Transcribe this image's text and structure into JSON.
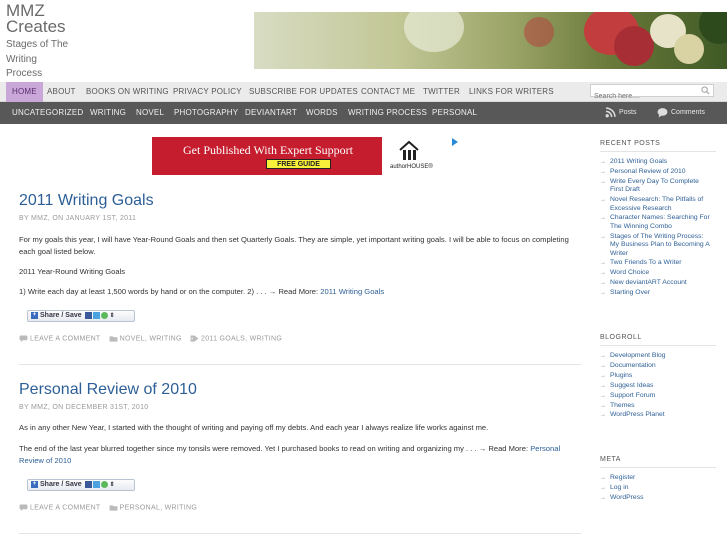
{
  "site": {
    "name_line1": "MMZ",
    "name_line2": "Creates",
    "desc_line1": "Stages of The",
    "desc_line2": "Writing",
    "desc_line3": "Process"
  },
  "nav_primary": {
    "items": [
      "HOME",
      "ABOUT",
      "BOOKS ON WRITING",
      "PRIVACY POLICY",
      "SUBSCRIBE FOR UPDATES",
      "CONTACT ME",
      "TWITTER",
      "LINKS FOR WRITERS"
    ],
    "active": "HOME"
  },
  "search": {
    "placeholder": "Search here...."
  },
  "nav_categories": {
    "items": [
      "UNCATEGORIZED",
      "WRITING",
      "NOVEL",
      "PHOTOGRAPHY",
      "DEVIANTART",
      "WORDS",
      "WRITING PROCESS",
      "PERSONAL"
    ],
    "feeds": [
      "Posts",
      "Comments"
    ]
  },
  "ad": {
    "headline": "Get Published With Expert Support",
    "badge": "FREE GUIDE",
    "brand": "authorHOUSE®"
  },
  "posts": [
    {
      "title": "2011 Writing Goals",
      "meta": "BY MMZ, ON JANUARY 1ST, 2011",
      "para1": "For my goals this year, I will have Year-Round Goals and then set Quarterly Goals. They are simple, yet important writing goals. I will be able to focus on completing each goal listed below.",
      "para2": "2011 Year-Round Writing Goals",
      "para3": "1) Write each day at least 1,500 words by hand or on the computer. 2) . . . → Read More:",
      "read_more": "2011 Writing Goals",
      "share": "Share / Save",
      "comment": "LEAVE A COMMENT",
      "categories": "NOVEL, WRITING",
      "tags": "2011 GOALS, WRITING"
    },
    {
      "title": "Personal Review of 2010",
      "meta": "BY MMZ, ON DECEMBER 31ST, 2010",
      "para1": "As in any other New Year, I started with the thought of writing and paying off my debts. And each year I always realize life works against me.",
      "para2": "The end of the last year blurred together since my tonsils were removed. Yet I purchased books to read on writing and organizing my . . . → Read More:",
      "read_more": "Personal Review of 2010",
      "share": "Share / Save",
      "comment": "LEAVE A COMMENT",
      "categories": "PERSONAL, WRITING"
    }
  ],
  "sidebar": {
    "recent_head": "RECENT POSTS",
    "recent": [
      "2011 Writing Goals",
      "Personal Review of 2010",
      "Write Every Day To Complete First Draft",
      "Novel Research: The Pitfalls of Excessive Research",
      "Character Names: Searching For The Winning Combo",
      "Stages of The Writing Process: My Business Plan to Becoming A Writer",
      "Two Friends To a Writer",
      "Word Choice",
      "New deviantART Account",
      "Starting Over"
    ],
    "blogroll_head": "BLOGROLL",
    "blogroll": [
      "Development Blog",
      "Documentation",
      "Plugins",
      "Suggest Ideas",
      "Support Forum",
      "Themes",
      "WordPress Planet"
    ],
    "meta_head": "META",
    "meta": [
      "Register",
      "Log in",
      "WordPress"
    ]
  }
}
